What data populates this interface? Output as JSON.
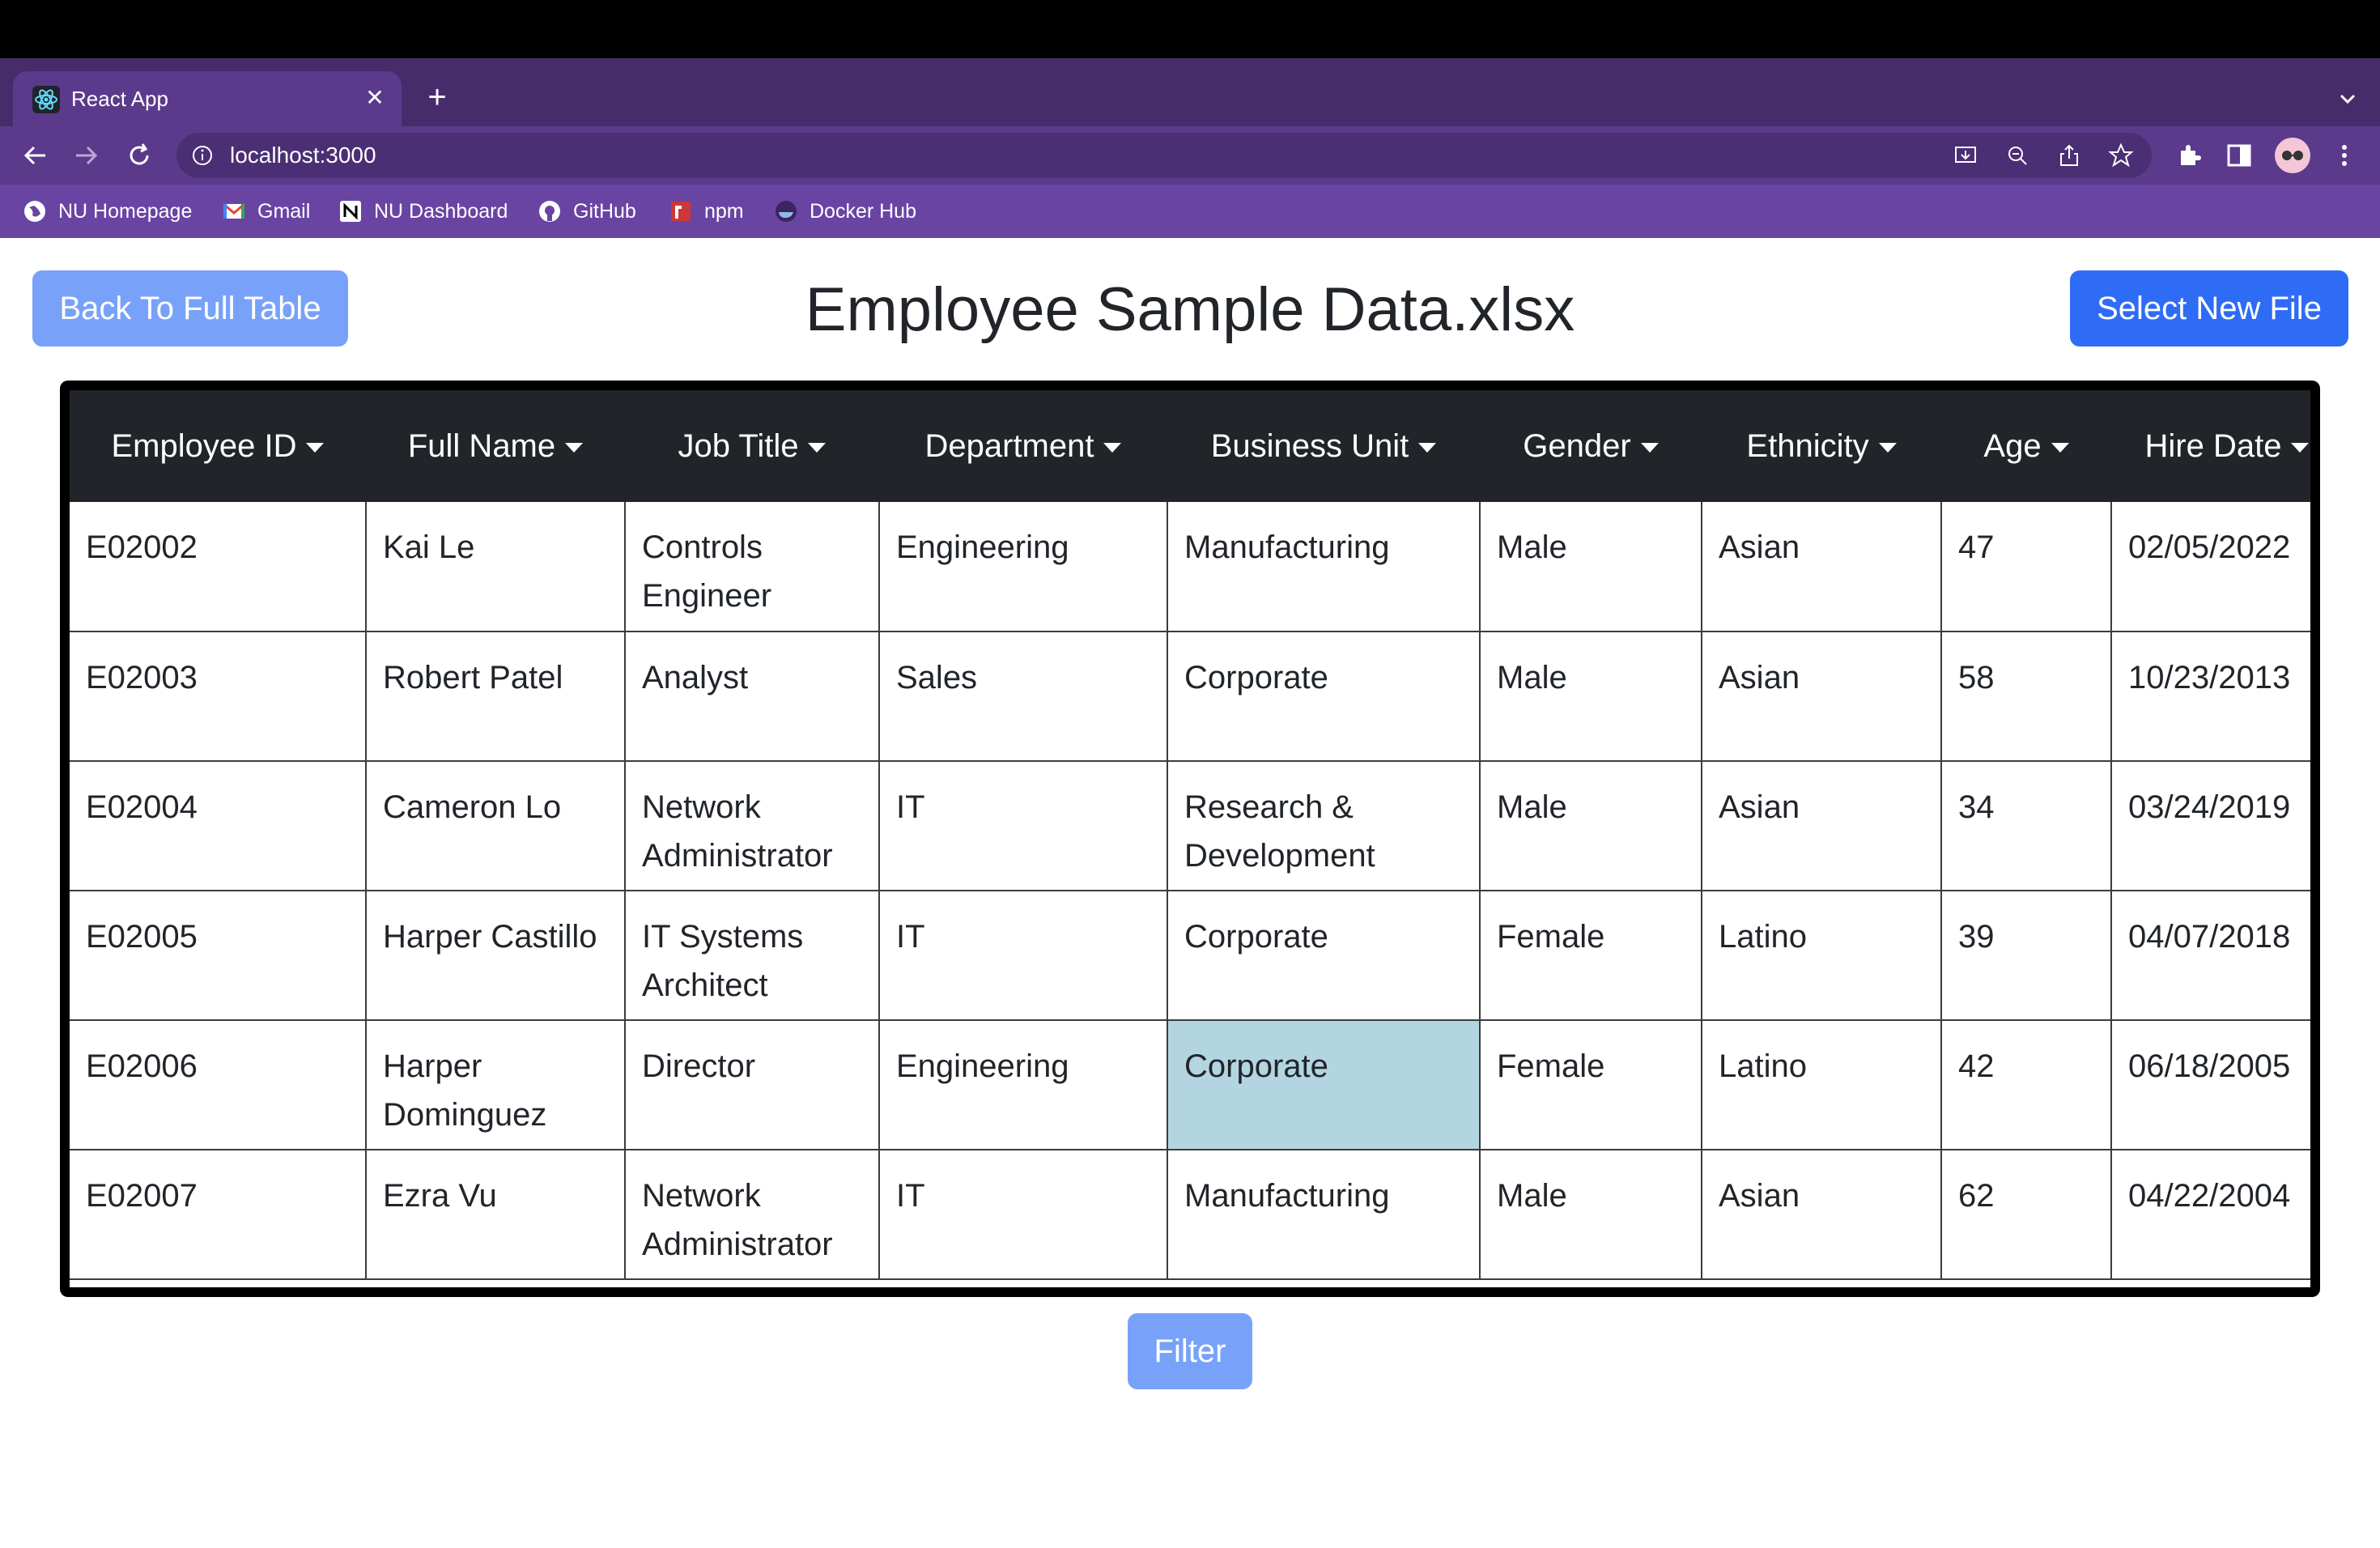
{
  "browser": {
    "tab_title": "React App",
    "url": "localhost:3000",
    "bookmarks": [
      {
        "label": "NU Homepage",
        "icon": "globe-icon"
      },
      {
        "label": "Gmail",
        "icon": "gmail-icon"
      },
      {
        "label": "NU Dashboard",
        "icon": "notion-icon"
      },
      {
        "label": "GitHub",
        "icon": "github-icon"
      },
      {
        "label": "npm",
        "icon": "npm-icon"
      },
      {
        "label": "Docker Hub",
        "icon": "docker-icon"
      }
    ]
  },
  "page": {
    "title": "Employee Sample Data.xlsx",
    "back_button": "Back To Full Table",
    "new_file_button": "Select New File",
    "filter_button": "Filter"
  },
  "table": {
    "columns": [
      "Employee ID",
      "Full Name",
      "Job Title",
      "Department",
      "Business Unit",
      "Gender",
      "Ethnicity",
      "Age",
      "Hire Date"
    ],
    "rows": [
      [
        "E02002",
        "Kai Le",
        "Controls Engineer",
        "Engineering",
        "Manufacturing",
        "Male",
        "Asian",
        "47",
        "02/05/2022"
      ],
      [
        "E02003",
        "Robert Patel",
        "Analyst",
        "Sales",
        "Corporate",
        "Male",
        "Asian",
        "58",
        "10/23/2013"
      ],
      [
        "E02004",
        "Cameron Lo",
        "Network Administrator",
        "IT",
        "Research & Development",
        "Male",
        "Asian",
        "34",
        "03/24/2019"
      ],
      [
        "E02005",
        "Harper Castillo",
        "IT Systems Architect",
        "IT",
        "Corporate",
        "Female",
        "Latino",
        "39",
        "04/07/2018"
      ],
      [
        "E02006",
        "Harper Dominguez",
        "Director",
        "Engineering",
        "Corporate",
        "Female",
        "Latino",
        "42",
        "06/18/2005"
      ],
      [
        "E02007",
        "Ezra Vu",
        "Network Administrator",
        "IT",
        "Manufacturing",
        "Male",
        "Asian",
        "62",
        "04/22/2004"
      ]
    ],
    "highlighted_cell": {
      "row": 4,
      "column": "Business Unit"
    }
  },
  "colors": {
    "header_bg": "#212529",
    "primary": "#2f6cf6",
    "primary_disabled": "#78a2f9",
    "highlight": "#b3d5e1",
    "chrome": "#5b3a8c"
  }
}
